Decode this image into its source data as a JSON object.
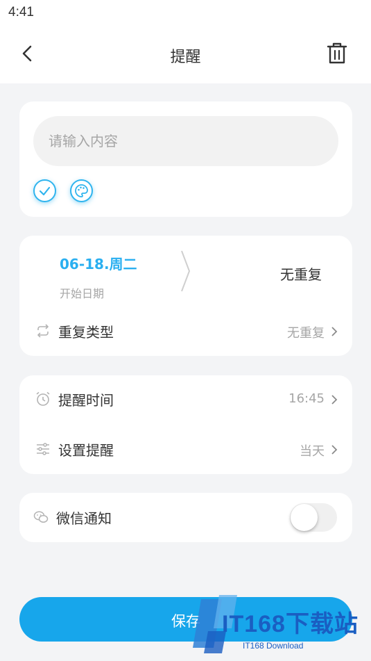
{
  "status_bar": {
    "time": "4:41"
  },
  "nav": {
    "title": "提醒",
    "icons": {
      "back": "back-arrow-icon",
      "delete": "trash-icon"
    }
  },
  "content": {
    "placeholder": "请输入内容",
    "value": "",
    "tools": [
      "check-circle-icon",
      "palette-icon"
    ]
  },
  "schedule": {
    "date_value": "06-18.周二",
    "date_label": "开始日期",
    "repeat_summary": "无重复",
    "repeat_type": {
      "label": "重复类型",
      "value": "无重复",
      "icon": "repeat-icon"
    }
  },
  "reminder": {
    "time": {
      "label": "提醒时间",
      "value": "16:45",
      "icon": "alarm-clock-icon"
    },
    "setting": {
      "label": "设置提醒",
      "value": "当天",
      "icon": "sliders-icon"
    }
  },
  "wechat": {
    "label": "微信通知",
    "enabled": false,
    "icon": "wechat-icon"
  },
  "save_label": "保存",
  "watermark": {
    "text": "IT168下载站",
    "subtext": "IT168 Download"
  },
  "colors": {
    "accent": "#17a6eb",
    "date_text": "#2aaff0",
    "background": "#f3f4f6",
    "muted_text": "#a6a6a6"
  }
}
